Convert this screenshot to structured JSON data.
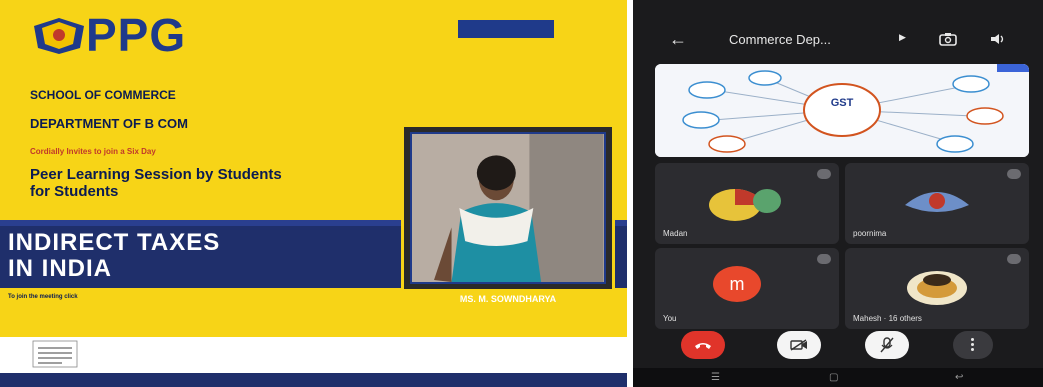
{
  "poster": {
    "logo_text": "PPG",
    "logo_subtitle": "",
    "tag_text": "",
    "school": "SCHOOL OF COMMERCE",
    "department": "DEPARTMENT OF B COM",
    "invite": "Cordially Invites to join a Six Day",
    "peer": "Peer Learning Session by Students for Students",
    "topic_line1": "INDIRECT TAXES",
    "topic_line2": "IN INDIA",
    "details_line1": "",
    "details_line2": "",
    "join_text": "To join the meeting click",
    "details_link": "",
    "speaker_name": "MS. M. SOWNDHARYA",
    "speaker_role": "",
    "speaker_college": "",
    "sig1": "",
    "sig2": "",
    "footer": "",
    "colors": {
      "yellow": "#f7d417",
      "navy": "#1f2f6b",
      "blue": "#1f3a8a",
      "red": "#c0392b"
    }
  },
  "phone": {
    "status_left": "",
    "status_right": "",
    "title": "Commerce Dep...",
    "share_center": "GST",
    "participants": [
      {
        "name": "Madan"
      },
      {
        "name": "poornima"
      },
      {
        "name": "You",
        "avatar": "m"
      },
      {
        "name": "Mahesh · 16 others"
      }
    ],
    "icons": [
      "back-arrow-icon",
      "switch-camera-icon",
      "speaker-icon",
      "end-call-icon",
      "camera-off-icon",
      "mic-off-icon",
      "more-icon"
    ]
  }
}
